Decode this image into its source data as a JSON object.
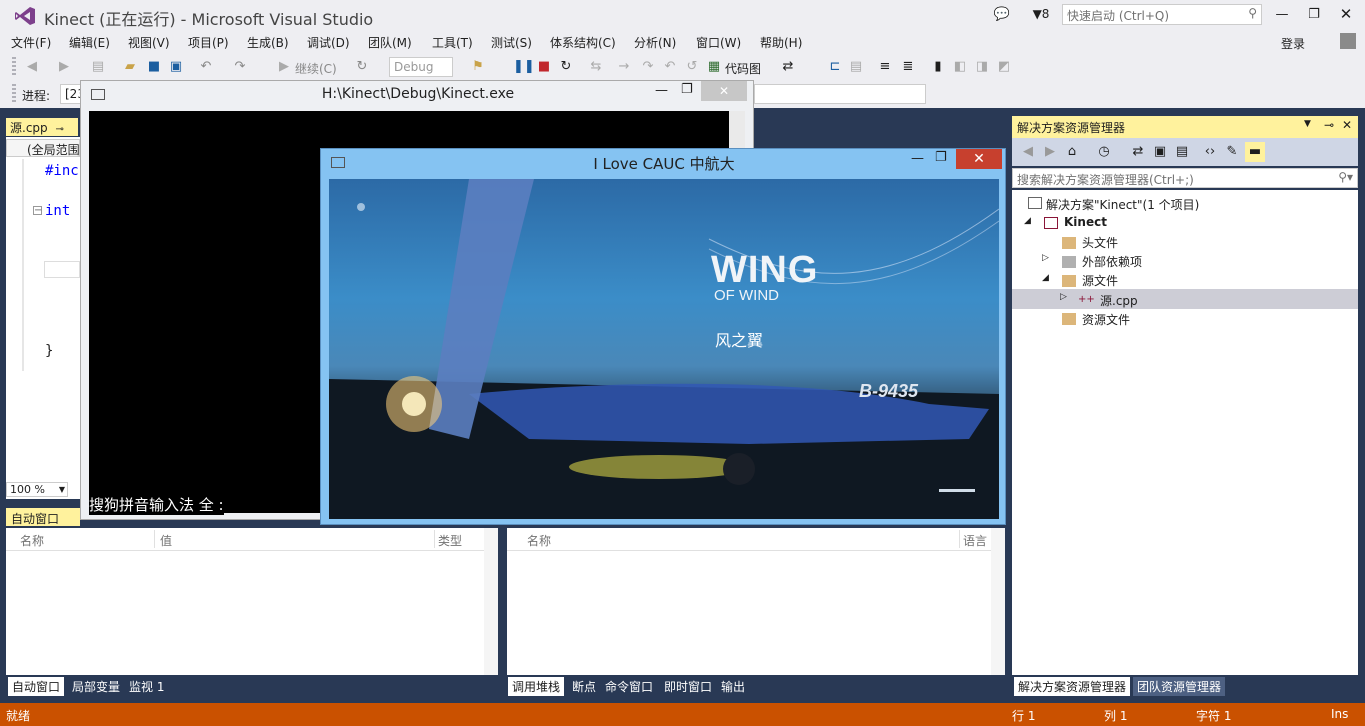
{
  "title_bar": {
    "title": "Kinect (正在运行) - Microsoft Visual Studio",
    "notifications_count": "8",
    "quick_launch_placeholder": "快速启动 (Ctrl+Q)"
  },
  "menu": {
    "items": [
      "文件(F)",
      "编辑(E)",
      "视图(V)",
      "项目(P)",
      "生成(B)",
      "调试(D)",
      "团队(M)",
      "工具(T)",
      "测试(S)",
      "体系结构(C)",
      "分析(N)",
      "窗口(W)",
      "帮助(H)"
    ],
    "signin": "登录"
  },
  "toolbar": {
    "continue_label": "继续(C)",
    "config_value": "Debug",
    "code_map_label": "代码图",
    "process_label": "进程:",
    "process_value": "[23"
  },
  "editor": {
    "tab_label": "源.cpp",
    "scope_value": "(全局范围",
    "code_lines": [
      "#inc",
      "int",
      "}"
    ],
    "zoom": "100 %"
  },
  "console_window": {
    "title": "H:\\Kinect\\Debug\\Kinect.exe",
    "ime_text": "搜狗拼音输入法 全 :"
  },
  "graphics_window": {
    "title": "I Love CAUC 中航大",
    "wing_title": "WING",
    "wing_subtitle": "OF WIND",
    "wing_cn": "风之翼",
    "plane_registration": "B-9435"
  },
  "autos_panel": {
    "title": "自动窗口",
    "columns": [
      "名称",
      "值",
      "类型"
    ],
    "tabs": [
      "自动窗口",
      "局部变量",
      "监视 1"
    ]
  },
  "callstack_panel": {
    "columns": [
      "名称",
      "语言"
    ],
    "tabs": [
      "调用堆栈",
      "断点",
      "命令窗口",
      "即时窗口",
      "输出"
    ]
  },
  "solution_explorer": {
    "title": "解决方案资源管理器",
    "search_placeholder": "搜索解决方案资源管理器(Ctrl+;)",
    "tree": [
      {
        "label": "解决方案\"Kinect\"(1 个项目)"
      },
      {
        "label": "Kinect"
      },
      {
        "label": "头文件"
      },
      {
        "label": "外部依赖项"
      },
      {
        "label": "源文件"
      },
      {
        "label": "源.cpp"
      },
      {
        "label": "资源文件"
      }
    ],
    "tabs": [
      "解决方案资源管理器",
      "团队资源管理器"
    ]
  },
  "status_bar": {
    "ready": "就绪",
    "line": "行 1",
    "col": "列 1",
    "char": "字符 1",
    "mode": "Ins"
  },
  "colors": {
    "accent_status": "#ca5100",
    "dark_bg": "#293955",
    "tab_highlight": "#fff29d"
  }
}
